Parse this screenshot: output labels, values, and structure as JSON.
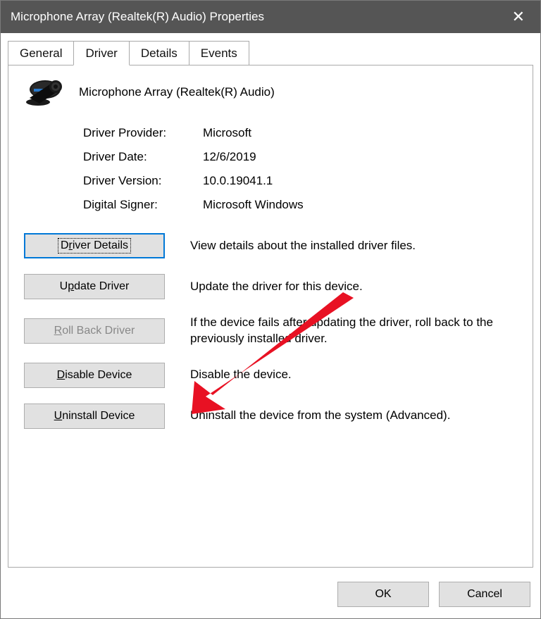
{
  "window": {
    "title": "Microphone Array (Realtek(R) Audio) Properties"
  },
  "tabs": {
    "general": "General",
    "driver": "Driver",
    "details": "Details",
    "events": "Events"
  },
  "device": {
    "name": "Microphone Array (Realtek(R) Audio)"
  },
  "info": {
    "provider_label": "Driver Provider:",
    "provider_value": "Microsoft",
    "date_label": "Driver Date:",
    "date_value": "12/6/2019",
    "version_label": "Driver Version:",
    "version_value": "10.0.19041.1",
    "signer_label": "Digital Signer:",
    "signer_value": "Microsoft Windows"
  },
  "actions": {
    "driver_details": {
      "label_pre": "D",
      "label_u": "r",
      "label_post": "iver Details",
      "desc": "View details about the installed driver files."
    },
    "update_driver": {
      "label_pre": "U",
      "label_u": "p",
      "label_post": "date Driver",
      "desc": "Update the driver for this device."
    },
    "rollback": {
      "label_pre": "",
      "label_u": "R",
      "label_post": "oll Back Driver",
      "desc": "If the device fails after updating the driver, roll back to the previously installed driver."
    },
    "disable": {
      "label_pre": "",
      "label_u": "D",
      "label_post": "isable Device",
      "desc": "Disable the device."
    },
    "uninstall": {
      "label_pre": "",
      "label_u": "U",
      "label_post": "ninstall Device",
      "desc": "Uninstall the device from the system (Advanced)."
    }
  },
  "buttons": {
    "ok": "OK",
    "cancel": "Cancel"
  }
}
